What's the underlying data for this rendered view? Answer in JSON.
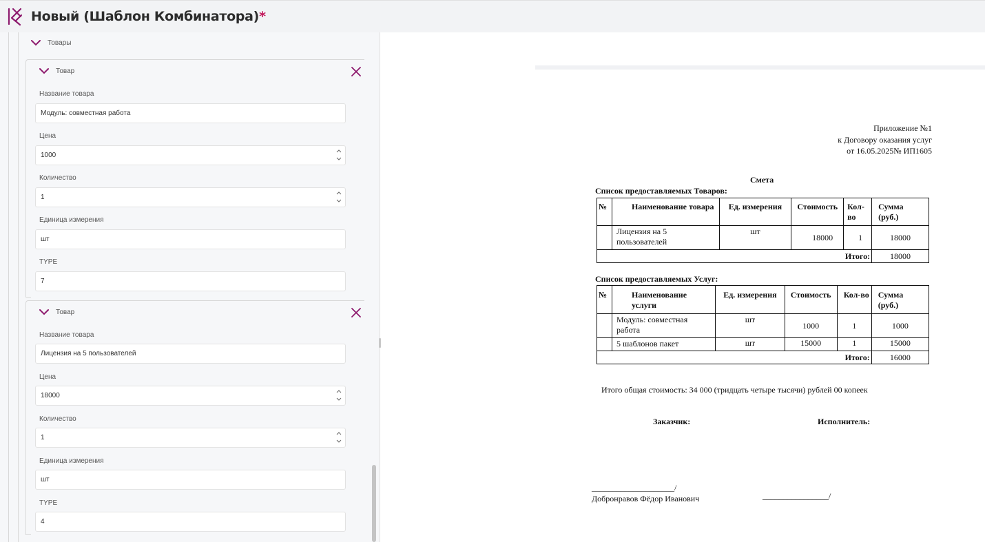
{
  "header": {
    "title": "Новый (Шаблон Комбинатора)",
    "required_mark": "*",
    "logo_icon": "combinator-logo-icon",
    "accent_color": "#8e1b6e"
  },
  "form": {
    "section_title": "Товары",
    "items": [
      {
        "title": "Товар",
        "fields": [
          {
            "label": "Название товара",
            "value": "Модуль: совместная работа",
            "spinner": false
          },
          {
            "label": "Цена",
            "value": "1000",
            "spinner": true
          },
          {
            "label": "Количество",
            "value": "1",
            "spinner": true
          },
          {
            "label": "Единица измерения",
            "value": "шт",
            "spinner": false
          },
          {
            "label": "TYPE",
            "value": "7",
            "spinner": false
          }
        ]
      },
      {
        "title": "Товар",
        "fields": [
          {
            "label": "Название товара",
            "value": "Лицензия на 5 пользователей",
            "spinner": false
          },
          {
            "label": "Цена",
            "value": "18000",
            "spinner": true
          },
          {
            "label": "Количество",
            "value": "1",
            "spinner": true
          },
          {
            "label": "Единица измерения",
            "value": "шт",
            "spinner": false
          },
          {
            "label": "TYPE",
            "value": "4",
            "spinner": false
          }
        ]
      }
    ]
  },
  "document": {
    "appendix": [
      "Приложение №1",
      "к Договору оказания услуг",
      "от 16.05.2025№ ИП1605"
    ],
    "title": "Смета",
    "goods": {
      "heading": "Список предоставляемых Товаров:",
      "columns": [
        "№",
        "Наименование товара",
        "Ед. измерения",
        "Стоимость",
        "Кол-во",
        "Сумма (руб.)"
      ],
      "rows": [
        {
          "num": "",
          "name": "Лицензия на 5 пользователей",
          "unit": "шт",
          "price": "18000",
          "qty": "1",
          "sum": "18000"
        }
      ],
      "total_label": "Итого:",
      "total_value": "18000"
    },
    "services": {
      "heading": "Список предоставляемых Услуг:",
      "columns": [
        "№",
        "Наименование услуги",
        "Ед. измерения",
        "Стоимость",
        "Кол-во",
        "Сумма (руб.)"
      ],
      "rows": [
        {
          "num": "",
          "name": "Модуль: совместная работа",
          "unit": "шт",
          "price": "1000",
          "qty": "1",
          "sum": "1000"
        },
        {
          "num": "",
          "name": "5 шаблонов пакет",
          "unit": "шт",
          "price": "15000",
          "qty": "1",
          "sum": "15000"
        }
      ],
      "total_label": "Итого:",
      "total_value": "16000"
    },
    "grand_total": "Итого общая стоимость:  34 000 (тридцать четыре тысячи) рублей 00 копеек",
    "customer_label": "Заказчик:",
    "executor_label": "Исполнитель:",
    "customer_signature": "____________________/",
    "customer_name": "Добронравов Фёдор Иванович",
    "executor_signature": "________________/"
  }
}
